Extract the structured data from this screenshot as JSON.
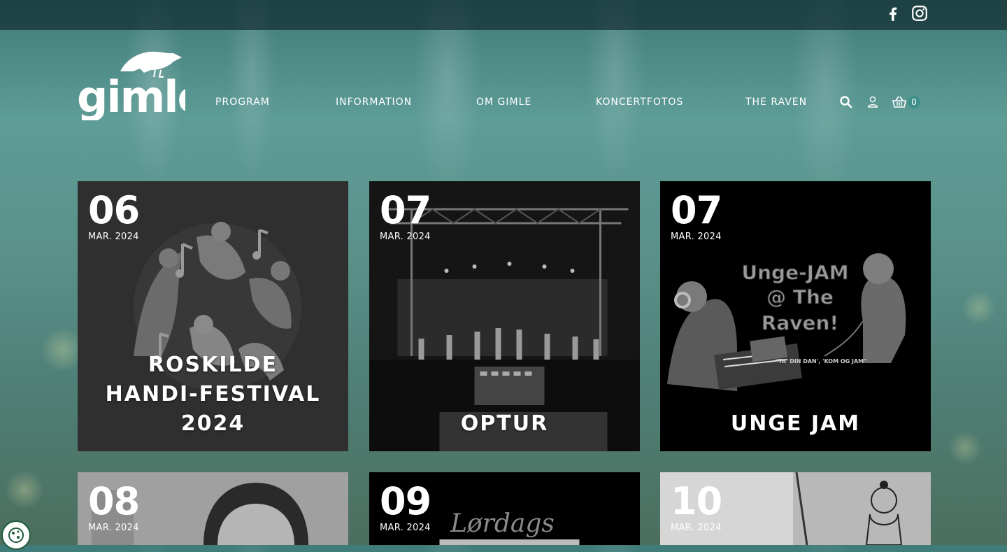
{
  "header": {
    "social": [
      {
        "name": "facebook-icon"
      },
      {
        "name": "instagram-icon"
      }
    ],
    "logo_text": "gimle",
    "nav": [
      {
        "label": "PROGRAM"
      },
      {
        "label": "INFORMATION"
      },
      {
        "label": "OM GIMLE"
      },
      {
        "label": "KONCERTFOTOS"
      },
      {
        "label": "THE RAVEN"
      }
    ],
    "cart_count": "0"
  },
  "events": [
    {
      "day": "06",
      "month": "MAR. 2024",
      "title": "ROSKILDE HANDI-FESTIVAL 2024"
    },
    {
      "day": "07",
      "month": "MAR. 2024",
      "title": "OPTUR"
    },
    {
      "day": "07",
      "month": "MAR. 2024",
      "title": "UNGE JAM",
      "poster_text_1": "Unge-JAM",
      "poster_text_2": "@ The",
      "poster_text_3": "Raven!",
      "poster_subtitle": "\"TA' DIN DAN', 'KOM OG JAM\""
    },
    {
      "day": "08",
      "month": "MAR. 2024",
      "title": ""
    },
    {
      "day": "09",
      "month": "MAR. 2024",
      "title": "",
      "poster_text": "Lørdags"
    },
    {
      "day": "10",
      "month": "MAR. 2024",
      "title": ""
    }
  ],
  "colors": {
    "accent": "#3d8f89",
    "card_dark": "#2f2f2f",
    "card_black": "#000000"
  }
}
